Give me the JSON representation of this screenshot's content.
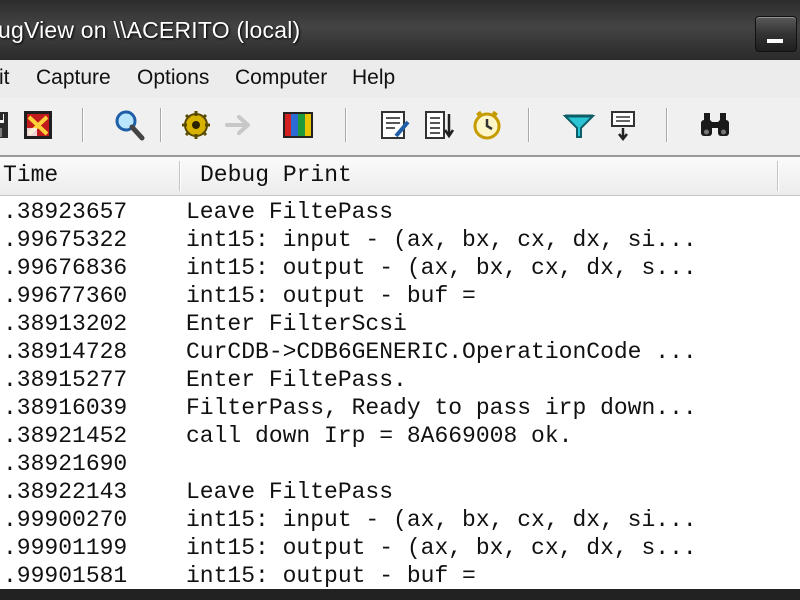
{
  "window": {
    "title": "ugView on \\\\ACERITO (local)"
  },
  "menu": {
    "items": [
      {
        "label": "it"
      },
      {
        "label": "Capture"
      },
      {
        "label": "Options"
      },
      {
        "label": "Computer"
      },
      {
        "label": "Help"
      }
    ]
  },
  "toolbar": {
    "buttons": [
      {
        "icon": "save-icon"
      },
      {
        "icon": "clear-display-icon"
      },
      {
        "icon": "find-icon"
      },
      {
        "icon": "capture-gear-icon"
      },
      {
        "icon": "autoscroll-arrow-icon"
      },
      {
        "icon": "capture-win32-icon"
      },
      {
        "icon": "edit-filter-icon"
      },
      {
        "icon": "scroll-down-icon"
      },
      {
        "icon": "clock-time-icon"
      },
      {
        "icon": "filter-funnel-icon"
      },
      {
        "icon": "highlight-icon"
      },
      {
        "icon": "binoculars-icon"
      }
    ]
  },
  "columns": {
    "time": "Time",
    "debug_print": "Debug Print"
  },
  "rows": [
    {
      "time": ".38923657",
      "msg": "Leave FiltePass"
    },
    {
      "time": ".99675322",
      "msg": "int15: input - (ax, bx, cx, dx, si..."
    },
    {
      "time": ".99676836",
      "msg": "int15: output - (ax, bx, cx, dx, s..."
    },
    {
      "time": ".99677360",
      "msg": "int15: output - buf ="
    },
    {
      "time": ".38913202",
      "msg": "Enter FilterScsi"
    },
    {
      "time": ".38914728",
      "msg": "CurCDB->CDB6GENERIC.OperationCode ..."
    },
    {
      "time": ".38915277",
      "msg": "Enter FiltePass."
    },
    {
      "time": ".38916039",
      "msg": "FilterPass, Ready to pass irp down..."
    },
    {
      "time": ".38921452",
      "msg": "call down Irp = 8A669008 ok."
    },
    {
      "time": ".38921690",
      "msg": ""
    },
    {
      "time": ".38922143",
      "msg": "Leave FiltePass"
    },
    {
      "time": ".99900270",
      "msg": "int15: input - (ax, bx, cx, dx, si..."
    },
    {
      "time": ".99901199",
      "msg": "int15: output - (ax, bx, cx, dx, s..."
    },
    {
      "time": ".99901581",
      "msg": "int15: output - buf ="
    }
  ]
}
